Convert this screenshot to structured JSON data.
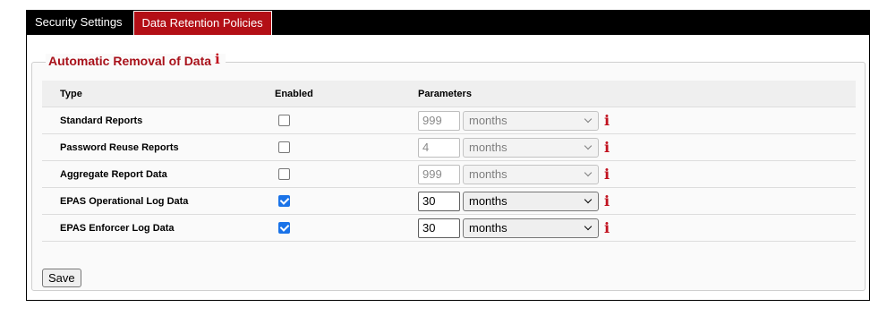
{
  "tabs": [
    {
      "label": "Security Settings",
      "active": false
    },
    {
      "label": "Data Retention Policies",
      "active": true
    }
  ],
  "section": {
    "title": "Automatic Removal of Data",
    "info_icon": "i"
  },
  "table": {
    "headers": {
      "type": "Type",
      "enabled": "Enabled",
      "parameters": "Parameters"
    },
    "rows": [
      {
        "type": "Standard Reports",
        "enabled": false,
        "value": "999",
        "unit": "months"
      },
      {
        "type": "Password Reuse Reports",
        "enabled": false,
        "value": "4",
        "unit": "months"
      },
      {
        "type": "Aggregate Report Data",
        "enabled": false,
        "value": "999",
        "unit": "months"
      },
      {
        "type": "EPAS Operational Log Data",
        "enabled": true,
        "value": "30",
        "unit": "months"
      },
      {
        "type": "EPAS Enforcer Log Data",
        "enabled": true,
        "value": "30",
        "unit": "months"
      }
    ]
  },
  "save_label": "Save",
  "colors": {
    "tab_active_bg": "#b30f16",
    "title_color": "#a8111a",
    "checkbox_checked": "#1a73e8",
    "info_icon": "#c1121f"
  },
  "icons": {
    "info": "info-icon",
    "select_arrow": "chevron-down-icon",
    "checkbox": "checkbox-icon"
  }
}
